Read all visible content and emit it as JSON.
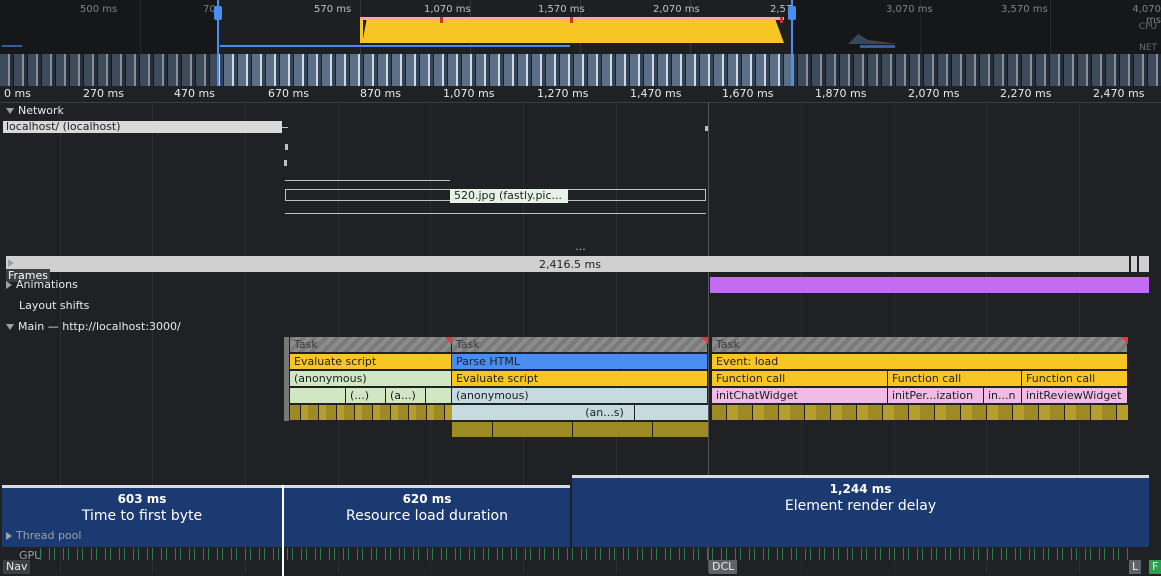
{
  "overview": {
    "ticks": [
      "500 ms",
      "70",
      "570 ms",
      "1,070 ms",
      "1,570 ms",
      "2,070 ms",
      "2,57",
      "3,070 ms",
      "3,570 ms",
      "4,070 ms"
    ],
    "cpu_label": "CPU",
    "net_label": "NET"
  },
  "ruler": {
    "ticks": [
      "0 ms",
      "270 ms",
      "470 ms",
      "670 ms",
      "870 ms",
      "1,070 ms",
      "1,270 ms",
      "1,470 ms",
      "1,670 ms",
      "1,870 ms",
      "2,070 ms",
      "2,270 ms",
      "2,470 ms"
    ]
  },
  "network": {
    "title": "Network",
    "row1_label": "localhost/ (localhost)",
    "row2_label": "520.jpg (fastly.pic..."
  },
  "tracks": {
    "more_handle": "...",
    "frames": "Frames",
    "frames_duration": "2,416.5 ms",
    "animations": "Animations",
    "layout_shifts": "Layout shifts",
    "main": "Main — http://localhost:3000/",
    "thread_pool": "Thread pool",
    "gpu": "GPU"
  },
  "flame": {
    "task": "Task",
    "evaluate_script": "Evaluate script",
    "anonymous": "(anonymous)",
    "anon_short1": "(...)",
    "anon_short2": "(a...)",
    "parse_html": "Parse HTML",
    "evaluate_script2": "Evaluate script",
    "anonymous2": "(anonymous)",
    "anon_s": "(an...s)",
    "event_load": "Event: load",
    "function_call": "Function call",
    "init_chat": "initChatWidget",
    "init_per": "initPer...ization",
    "init_n": "in...n",
    "init_review": "initReviewWidget"
  },
  "phases": [
    {
      "ms": "603 ms",
      "name": "Time to first byte"
    },
    {
      "ms": "620 ms",
      "name": "Resource load duration"
    },
    {
      "ms": "1,244 ms",
      "name": "Element render delay"
    }
  ],
  "markers": {
    "nav": "Nav",
    "dcl": "DCL",
    "l": "L",
    "f": "F"
  },
  "colors": {
    "script": "#f7c624",
    "parse": "#4a8df0",
    "animation": "#c36bf2",
    "phase": "#1c3a72"
  }
}
